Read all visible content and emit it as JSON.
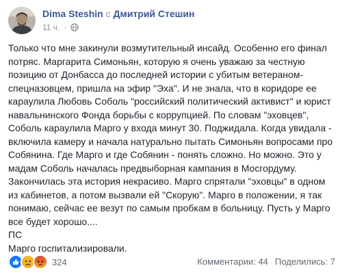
{
  "post": {
    "author": "Dima Steshin",
    "with_text": "с",
    "with_name": "Дмитрий Стешин",
    "timestamp": "11 ч.",
    "privacy_icon": "globe-icon",
    "text_lines": [
      "Только что мне закинули возмутительный инсайд. Особенно его финал",
      "потряс. Маргарита Симоньян, которую я очень уважаю за честную",
      "позицию от Донбасса до последней истории с убитым ветераном-",
      "спецназовцем, пришла на эфир \"Эха\". И не знала, что в коридоре ее",
      "караулила Любовь Соболь \"российский политический активист\" и юрист",
      "навальнинского Фонда борьбы с коррупцией. По словам \"эховцев\",",
      "Соболь караулила Марго у входа минут 30. Поджидала. Когда увидала -",
      "включила камеру и начала натурально пытать Симоньян вопросами про",
      "Собянина. Где Марго и где Собянин - понять сложно. Но можно. Это у",
      "мадам Соболь началась предвыборная кампания в Мосгордуму.",
      "Закончилась эта история некрасиво. Марго спрятали \"эховцы\" в одном",
      "из кабинетов, а потом вызвали ей \"Скорую\". Марго в положении, я так",
      "понимаю, сейчас ее везут по самым пробкам в больницу. Пусть у Марго",
      "все будет хорошо....",
      "ПС",
      "Марго госпитализировали."
    ]
  },
  "footer": {
    "reactions": [
      "like",
      "sad",
      "angry"
    ],
    "reaction_count": "324",
    "comments_label": "Комментарии: 44",
    "shares_label": "Поделились: 7"
  },
  "colors": {
    "link": "#385898",
    "meta": "#90949c",
    "like": "#1877f2",
    "sad": "#f7b125",
    "angry": "#e9710f"
  }
}
